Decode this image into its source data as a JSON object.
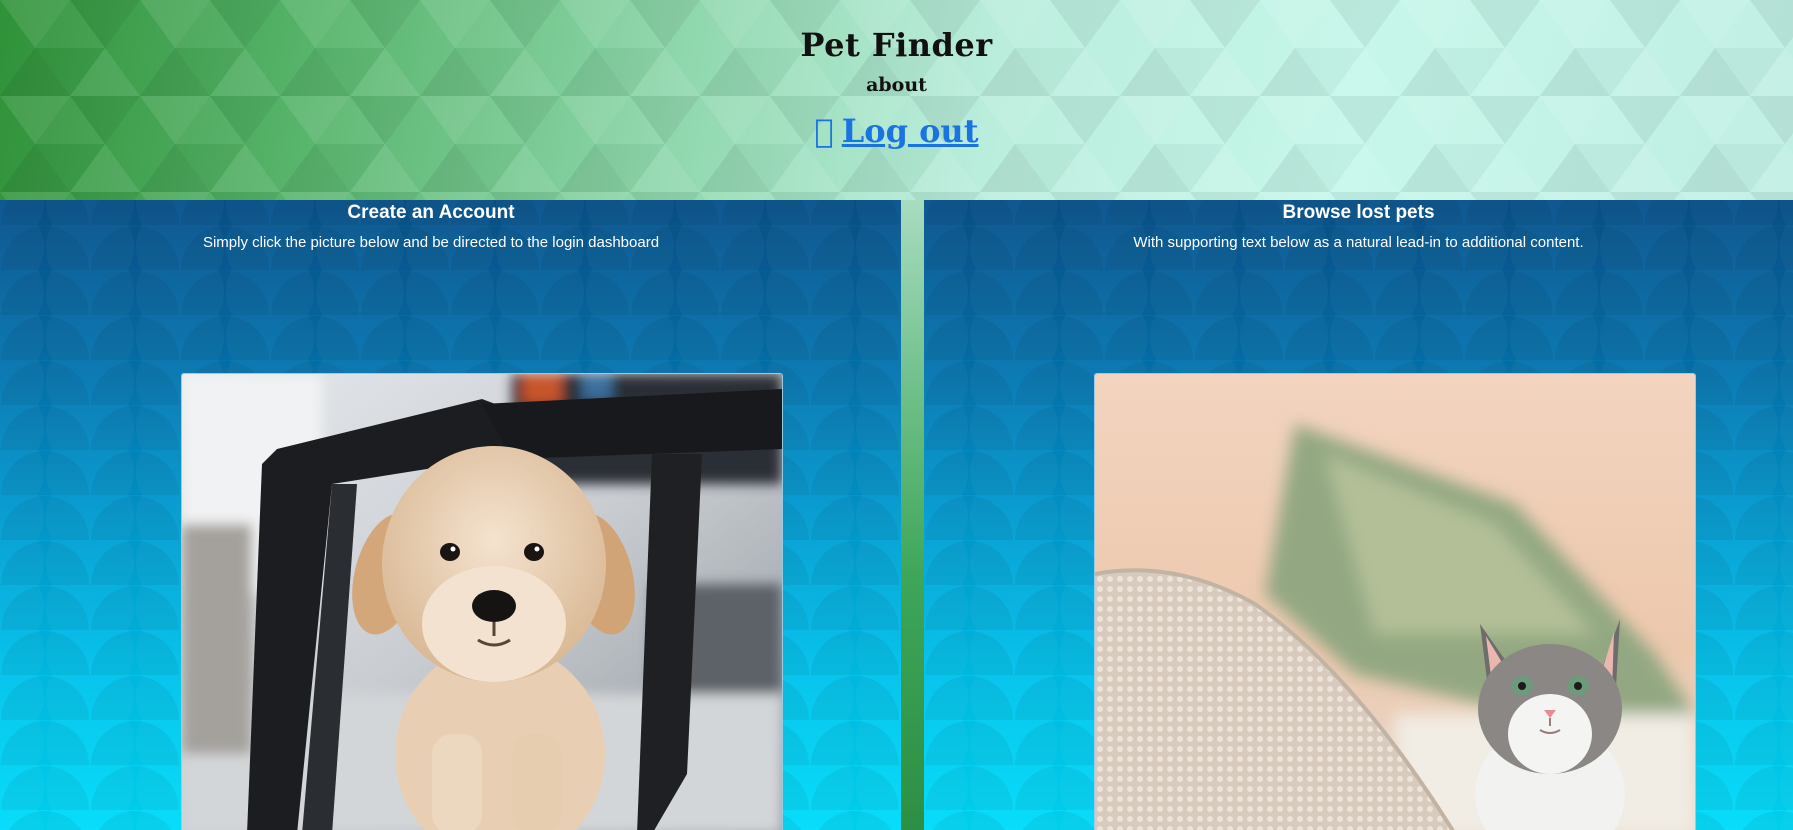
{
  "header": {
    "title": "Pet Finder",
    "about": "about",
    "logout_icon": "",
    "logout_label": "Log out"
  },
  "panels": [
    {
      "title": "Create an Account",
      "text": "Simply click the picture below and be directed to the login dashboard",
      "image": "golden-retriever-puppy-photo"
    },
    {
      "title": "Browse lost pets",
      "text": "With supporting text below as a natural lead-in to additional content.",
      "image": "tabby-kitten-photo"
    }
  ],
  "colors": {
    "header_green": "#2f9138",
    "header_mint": "#c6f7ea",
    "panel_top": "#08528c",
    "panel_bottom": "#00dcfb",
    "link": "#1a73e0"
  }
}
